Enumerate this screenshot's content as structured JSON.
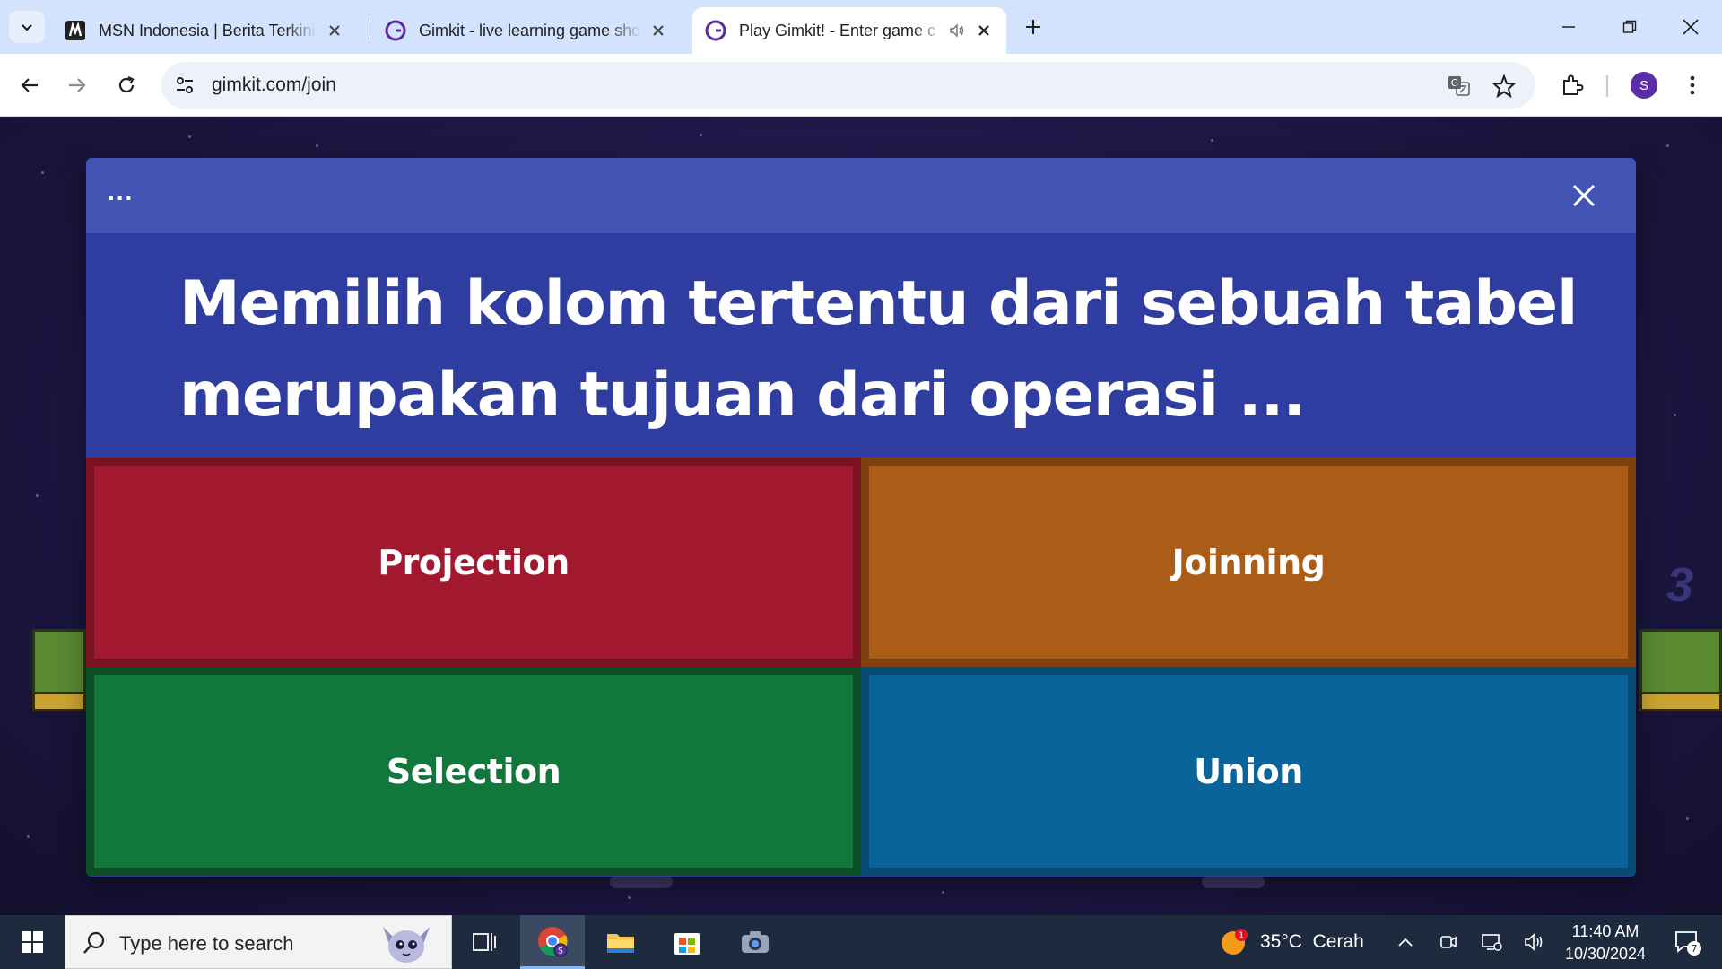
{
  "browser": {
    "tabs": [
      {
        "title": "MSN Indonesia | Berita Terkini H",
        "favicon": "msn-icon",
        "active": false
      },
      {
        "title": "Gimkit - live learning game sho",
        "favicon": "gimkit-icon",
        "active": false
      },
      {
        "title": "Play Gimkit! - Enter game c",
        "favicon": "gimkit-icon",
        "active": true,
        "audio": true
      }
    ],
    "url": "gimkit.com/join",
    "profile_initial": "S"
  },
  "modal": {
    "menu_dots": "...",
    "question": "Memilih kolom tertentu dari sebuah tabel merupakan tujuan dari operasi ...",
    "answers": [
      {
        "label": "Projection",
        "color": "#a2192f"
      },
      {
        "label": "Joinning",
        "color": "#ab5c16"
      },
      {
        "label": "Selection",
        "color": "#12773a"
      },
      {
        "label": "Union",
        "color": "#0b6499"
      }
    ]
  },
  "background": {
    "number": "3"
  },
  "taskbar": {
    "search_placeholder": "Type here to search",
    "weather_temp": "35°C",
    "weather_desc": "Cerah",
    "weather_badge": "1",
    "time": "11:40 AM",
    "date": "10/30/2024",
    "notification_count": "7"
  },
  "colors": {
    "tabstrip": "#d3e3fd",
    "modal_header": "#4353b4",
    "modal_body": "#2f3ca0",
    "taskbar": "#1e2b3f"
  }
}
